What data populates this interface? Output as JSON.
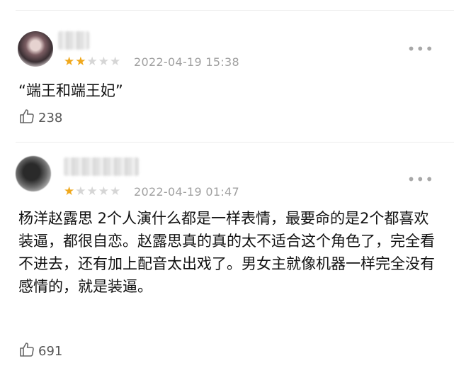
{
  "reviews": [
    {
      "rating": 2,
      "max_rating": 5,
      "date": "2022-04-19 15:38",
      "content": "“端王和端王妃”",
      "likes": "238",
      "more_label": "•••",
      "avatar_icon": "user-avatar-icon"
    },
    {
      "rating": 1,
      "max_rating": 5,
      "date": "2022-04-19 01:47",
      "content": "杨洋赵露思 2个人演什么都是一样表情，最要命的是2个都喜欢装逼，都很自恋。赵露思真的真的太不适合这个角色了，完全看不进去，还有加上配音太出戏了。男女主就像机器一样完全没有感情的，就是装逼。",
      "likes": "691",
      "more_label": "•••",
      "avatar_icon": "user-avatar-icon"
    }
  ],
  "colors": {
    "star_on": "#f0a81c",
    "star_off": "#d6d6d6",
    "meta_text": "#a0a0a0"
  }
}
